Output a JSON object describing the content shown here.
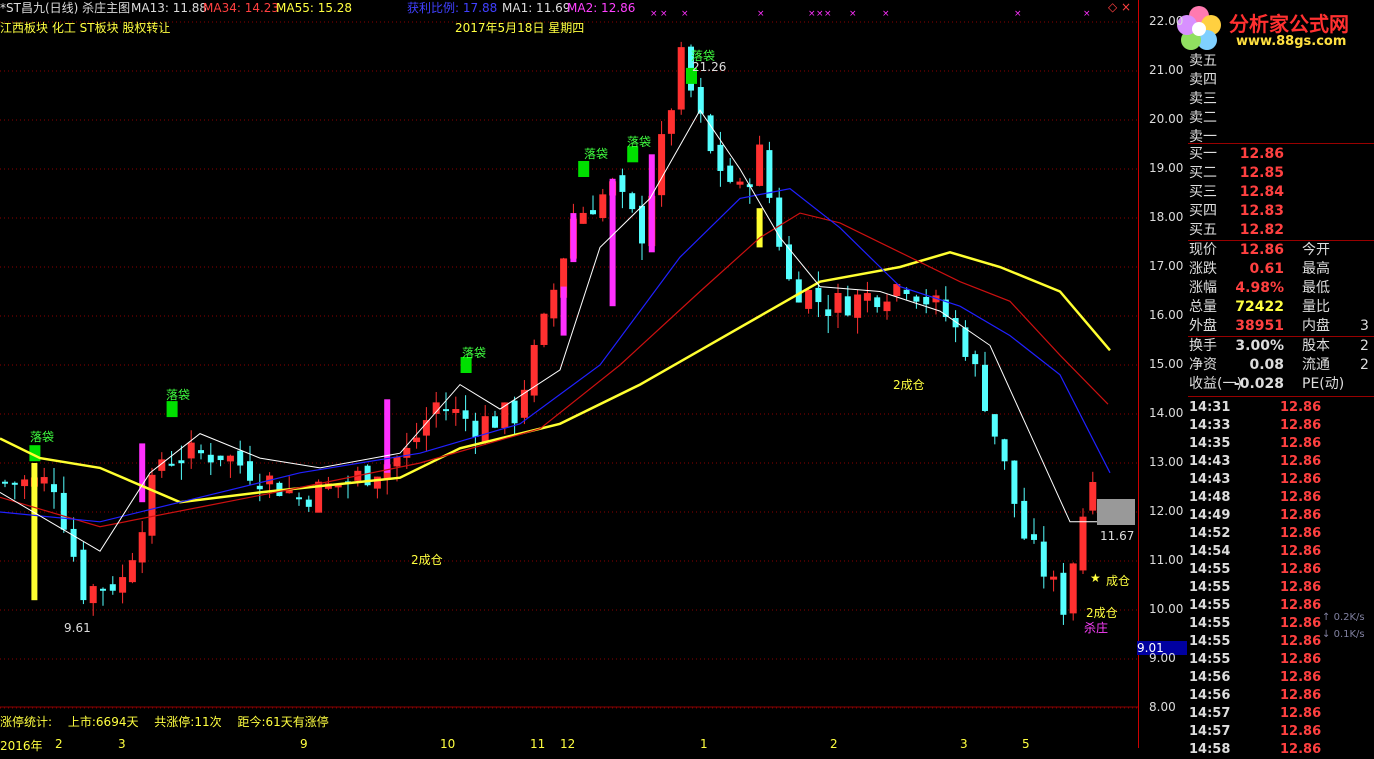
{
  "header": {
    "title": "*ST昌九(日线) 杀庄主图",
    "ma13": "MA13: 11.88",
    "ma34": "MA34: 14.23",
    "ma55": "MA55: 15.28",
    "profit_ratio": "获利比例: 17.88",
    "ma1": "MA1: 11.69",
    "ma2": "MA2: 12.86"
  },
  "sectors": "江西板块 化工 ST板块 股权转让",
  "date": "2017年5月18日 星期四",
  "logo": {
    "name": "分析家公式网",
    "url": "www.88gs.com"
  },
  "annotations": {
    "label_drop": "落袋",
    "high_price": "21.26",
    "low_price": "9.61",
    "cur_price": "11.67",
    "pos1": "2成仓",
    "pos2": "2成仓",
    "pos3": "成仓",
    "pos4": "2成仓",
    "kill": "杀庄"
  },
  "y_axis": [
    "22.00",
    "21.00",
    "20.00",
    "19.00",
    "18.00",
    "17.00",
    "16.00",
    "15.00",
    "14.00",
    "13.00",
    "12.00",
    "11.00",
    "10.00",
    "9.00",
    "8.00"
  ],
  "axis_marker": "9.01",
  "stats": {
    "label": "涨停统计:",
    "listed": "上市:6694天",
    "total": "共涨停:11次",
    "since": "距今:61天有涨停"
  },
  "date_axis": [
    "2016年",
    "2",
    "3",
    "9",
    "10",
    "11",
    "12",
    "1",
    "2",
    "3",
    "5"
  ],
  "orderbook": {
    "sells": [
      "卖五",
      "卖四",
      "卖三",
      "卖二",
      "卖一"
    ],
    "buys": [
      {
        "label": "买一",
        "price": "12.86"
      },
      {
        "label": "买二",
        "price": "12.85"
      },
      {
        "label": "买三",
        "price": "12.84"
      },
      {
        "label": "买四",
        "price": "12.83"
      },
      {
        "label": "买五",
        "price": "12.82"
      }
    ]
  },
  "quote": [
    {
      "l1": "现价",
      "v1": "12.86",
      "c1": "#ff4040",
      "l2": "今开",
      "v2": ""
    },
    {
      "l1": "涨跌",
      "v1": "0.61",
      "c1": "#ff4040",
      "l2": "最高",
      "v2": ""
    },
    {
      "l1": "涨幅",
      "v1": "4.98%",
      "c1": "#ff4040",
      "l2": "最低",
      "v2": ""
    },
    {
      "l1": "总量",
      "v1": "72422",
      "c1": "#ffff40",
      "l2": "量比",
      "v2": ""
    },
    {
      "l1": "外盘",
      "v1": "38951",
      "c1": "#ff4040",
      "l2": "内盘",
      "v2": "3"
    }
  ],
  "fundamentals": [
    {
      "l1": "换手",
      "v1": "3.00%",
      "l2": "股本",
      "v2": "2"
    },
    {
      "l1": "净资",
      "v1": "0.08",
      "l2": "流通",
      "v2": "2"
    },
    {
      "l1": "收益(一)",
      "v1": "-0.028",
      "l2": "PE(动)",
      "v2": ""
    }
  ],
  "ticks": [
    {
      "time": "14:31",
      "price": "12.86"
    },
    {
      "time": "14:33",
      "price": "12.86"
    },
    {
      "time": "14:35",
      "price": "12.86"
    },
    {
      "time": "14:43",
      "price": "12.86"
    },
    {
      "time": "14:43",
      "price": "12.86"
    },
    {
      "time": "14:48",
      "price": "12.86"
    },
    {
      "time": "14:49",
      "price": "12.86"
    },
    {
      "time": "14:52",
      "price": "12.86"
    },
    {
      "time": "14:54",
      "price": "12.86"
    },
    {
      "time": "14:55",
      "price": "12.86"
    },
    {
      "time": "14:55",
      "price": "12.86"
    },
    {
      "time": "14:55",
      "price": "12.86"
    },
    {
      "time": "14:55",
      "price": "12.86"
    },
    {
      "time": "14:55",
      "price": "12.86"
    },
    {
      "time": "14:55",
      "price": "12.86"
    },
    {
      "time": "14:56",
      "price": "12.86"
    },
    {
      "time": "14:56",
      "price": "12.86"
    },
    {
      "time": "14:57",
      "price": "12.86"
    },
    {
      "time": "14:57",
      "price": "12.86"
    },
    {
      "time": "14:58",
      "price": "12.86"
    }
  ],
  "net": {
    "up": "0.2K/s",
    "down": "0.1K/s"
  },
  "colors": {
    "up": "#ff3030",
    "down": "#54ffff",
    "ma_yellow": "#ffff30",
    "ma_red": "#c00000",
    "ma_blue": "#2020ff",
    "magenta": "#ff30ff",
    "green_box": "#00e000",
    "grid": "#8b0000"
  }
}
